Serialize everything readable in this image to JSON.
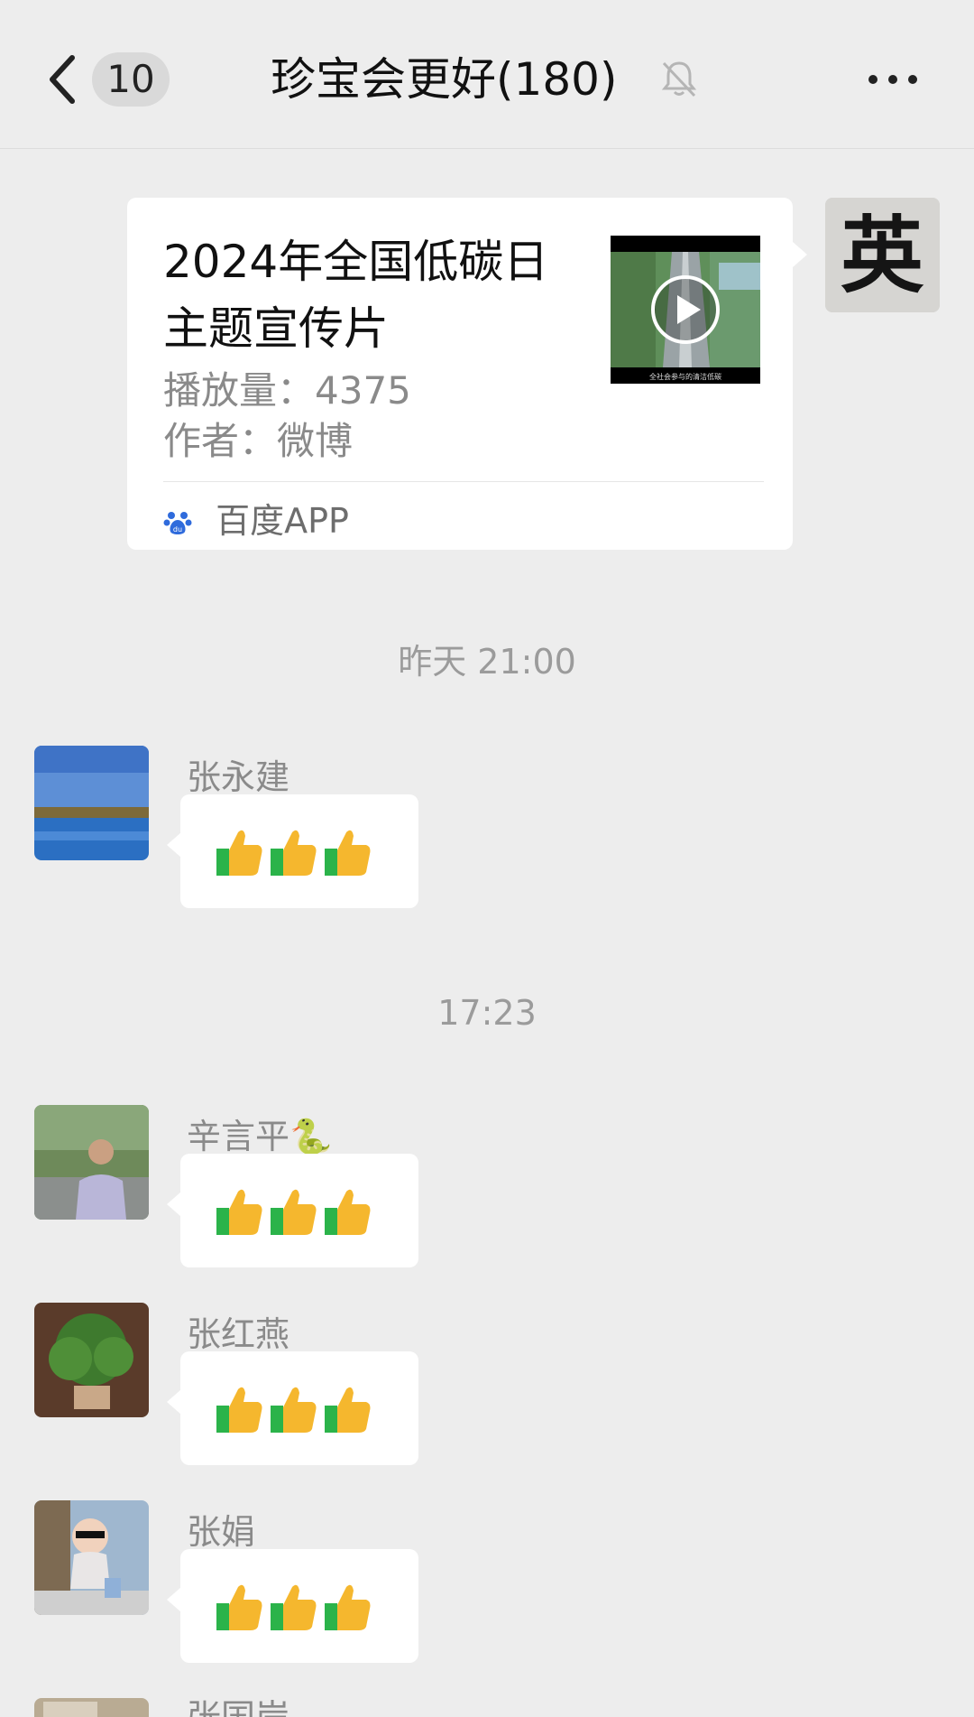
{
  "header": {
    "unread_count": "10",
    "title": "珍宝会更好(180)",
    "icons": [
      "back-chevron-icon",
      "mute-bell-icon",
      "more-dots-icon"
    ]
  },
  "card": {
    "title": "2024年全国低碳日主题宣传片",
    "plays": "播放量：4375",
    "author": "作者：微博",
    "source": "百度APP",
    "thumbnail_caption": "全社会参与的清洁低碳",
    "sender_avatar_char": "英"
  },
  "timestamps": [
    "昨天 21:00",
    "17:23"
  ],
  "messages": [
    {
      "sender": "张永建",
      "content": "👍👍👍"
    },
    {
      "sender": "辛言平🐍",
      "content": "👍👍👍"
    },
    {
      "sender": "张红燕",
      "content": "👍👍👍"
    },
    {
      "sender": "张娟",
      "content": "👍👍👍"
    },
    {
      "sender": "张国岸"
    }
  ],
  "colors": {
    "background": "#ededed",
    "bubble": "#ffffff",
    "secondary_text": "#8a8a8a",
    "thumb_yellow": "#f5b72e",
    "thumb_green": "#2bb34a"
  }
}
